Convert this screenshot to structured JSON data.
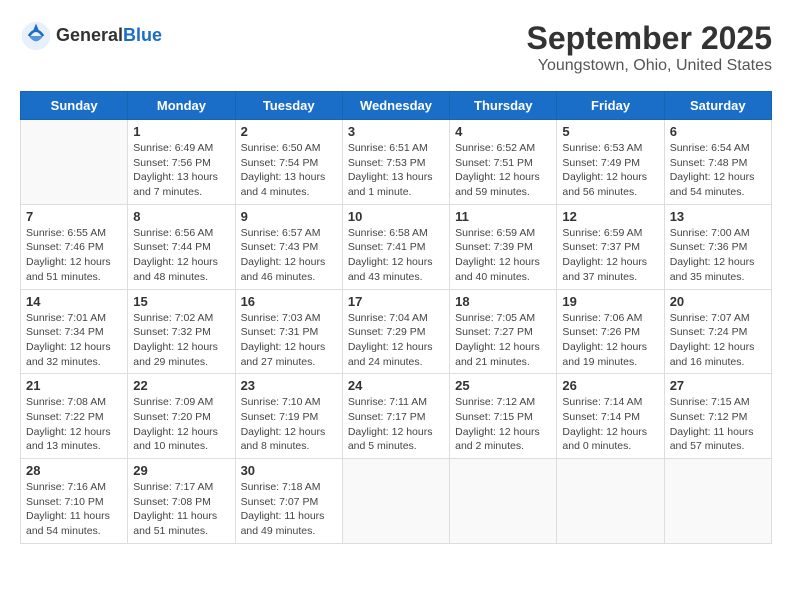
{
  "header": {
    "logo_line1": "General",
    "logo_line2": "Blue",
    "month": "September 2025",
    "location": "Youngstown, Ohio, United States"
  },
  "days_of_week": [
    "Sunday",
    "Monday",
    "Tuesday",
    "Wednesday",
    "Thursday",
    "Friday",
    "Saturday"
  ],
  "weeks": [
    [
      {
        "day": "",
        "info": ""
      },
      {
        "day": "1",
        "info": "Sunrise: 6:49 AM\nSunset: 7:56 PM\nDaylight: 13 hours\nand 7 minutes."
      },
      {
        "day": "2",
        "info": "Sunrise: 6:50 AM\nSunset: 7:54 PM\nDaylight: 13 hours\nand 4 minutes."
      },
      {
        "day": "3",
        "info": "Sunrise: 6:51 AM\nSunset: 7:53 PM\nDaylight: 13 hours\nand 1 minute."
      },
      {
        "day": "4",
        "info": "Sunrise: 6:52 AM\nSunset: 7:51 PM\nDaylight: 12 hours\nand 59 minutes."
      },
      {
        "day": "5",
        "info": "Sunrise: 6:53 AM\nSunset: 7:49 PM\nDaylight: 12 hours\nand 56 minutes."
      },
      {
        "day": "6",
        "info": "Sunrise: 6:54 AM\nSunset: 7:48 PM\nDaylight: 12 hours\nand 54 minutes."
      }
    ],
    [
      {
        "day": "7",
        "info": "Sunrise: 6:55 AM\nSunset: 7:46 PM\nDaylight: 12 hours\nand 51 minutes."
      },
      {
        "day": "8",
        "info": "Sunrise: 6:56 AM\nSunset: 7:44 PM\nDaylight: 12 hours\nand 48 minutes."
      },
      {
        "day": "9",
        "info": "Sunrise: 6:57 AM\nSunset: 7:43 PM\nDaylight: 12 hours\nand 46 minutes."
      },
      {
        "day": "10",
        "info": "Sunrise: 6:58 AM\nSunset: 7:41 PM\nDaylight: 12 hours\nand 43 minutes."
      },
      {
        "day": "11",
        "info": "Sunrise: 6:59 AM\nSunset: 7:39 PM\nDaylight: 12 hours\nand 40 minutes."
      },
      {
        "day": "12",
        "info": "Sunrise: 6:59 AM\nSunset: 7:37 PM\nDaylight: 12 hours\nand 37 minutes."
      },
      {
        "day": "13",
        "info": "Sunrise: 7:00 AM\nSunset: 7:36 PM\nDaylight: 12 hours\nand 35 minutes."
      }
    ],
    [
      {
        "day": "14",
        "info": "Sunrise: 7:01 AM\nSunset: 7:34 PM\nDaylight: 12 hours\nand 32 minutes."
      },
      {
        "day": "15",
        "info": "Sunrise: 7:02 AM\nSunset: 7:32 PM\nDaylight: 12 hours\nand 29 minutes."
      },
      {
        "day": "16",
        "info": "Sunrise: 7:03 AM\nSunset: 7:31 PM\nDaylight: 12 hours\nand 27 minutes."
      },
      {
        "day": "17",
        "info": "Sunrise: 7:04 AM\nSunset: 7:29 PM\nDaylight: 12 hours\nand 24 minutes."
      },
      {
        "day": "18",
        "info": "Sunrise: 7:05 AM\nSunset: 7:27 PM\nDaylight: 12 hours\nand 21 minutes."
      },
      {
        "day": "19",
        "info": "Sunrise: 7:06 AM\nSunset: 7:26 PM\nDaylight: 12 hours\nand 19 minutes."
      },
      {
        "day": "20",
        "info": "Sunrise: 7:07 AM\nSunset: 7:24 PM\nDaylight: 12 hours\nand 16 minutes."
      }
    ],
    [
      {
        "day": "21",
        "info": "Sunrise: 7:08 AM\nSunset: 7:22 PM\nDaylight: 12 hours\nand 13 minutes."
      },
      {
        "day": "22",
        "info": "Sunrise: 7:09 AM\nSunset: 7:20 PM\nDaylight: 12 hours\nand 10 minutes."
      },
      {
        "day": "23",
        "info": "Sunrise: 7:10 AM\nSunset: 7:19 PM\nDaylight: 12 hours\nand 8 minutes."
      },
      {
        "day": "24",
        "info": "Sunrise: 7:11 AM\nSunset: 7:17 PM\nDaylight: 12 hours\nand 5 minutes."
      },
      {
        "day": "25",
        "info": "Sunrise: 7:12 AM\nSunset: 7:15 PM\nDaylight: 12 hours\nand 2 minutes."
      },
      {
        "day": "26",
        "info": "Sunrise: 7:14 AM\nSunset: 7:14 PM\nDaylight: 12 hours\nand 0 minutes."
      },
      {
        "day": "27",
        "info": "Sunrise: 7:15 AM\nSunset: 7:12 PM\nDaylight: 11 hours\nand 57 minutes."
      }
    ],
    [
      {
        "day": "28",
        "info": "Sunrise: 7:16 AM\nSunset: 7:10 PM\nDaylight: 11 hours\nand 54 minutes."
      },
      {
        "day": "29",
        "info": "Sunrise: 7:17 AM\nSunset: 7:08 PM\nDaylight: 11 hours\nand 51 minutes."
      },
      {
        "day": "30",
        "info": "Sunrise: 7:18 AM\nSunset: 7:07 PM\nDaylight: 11 hours\nand 49 minutes."
      },
      {
        "day": "",
        "info": ""
      },
      {
        "day": "",
        "info": ""
      },
      {
        "day": "",
        "info": ""
      },
      {
        "day": "",
        "info": ""
      }
    ]
  ]
}
